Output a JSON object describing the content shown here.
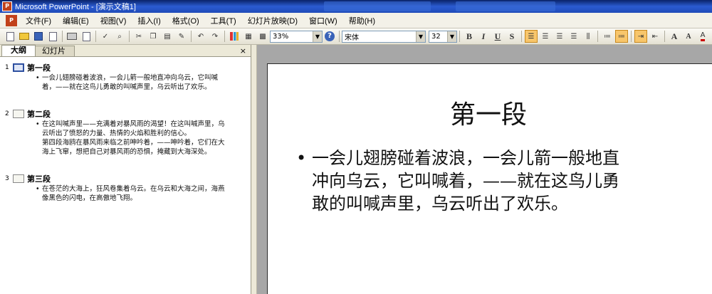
{
  "window": {
    "title": "Microsoft PowerPoint - [演示文稿1]"
  },
  "menu": [
    "文件(F)",
    "编辑(E)",
    "视图(V)",
    "插入(I)",
    "格式(O)",
    "工具(T)",
    "幻灯片放映(D)",
    "窗口(W)",
    "帮助(H)"
  ],
  "toolbar": {
    "zoom": "33%",
    "font_name": "宋体",
    "font_size": "32",
    "bold": "B",
    "italic": "I",
    "underline": "U",
    "shadow": "S",
    "grow_font": "A",
    "shrink_font": "A"
  },
  "pane": {
    "tab_outline": "大纲",
    "tab_slides": "幻灯片",
    "close": "×"
  },
  "outline": [
    {
      "num": "1",
      "title": "第一段",
      "lines": [
        "一会儿翅膀碰着波浪，一会儿箭一般地直冲向乌云，它叫喊",
        "着，——就在这鸟儿勇敢的叫喊声里，乌云听出了欢乐。"
      ]
    },
    {
      "num": "2",
      "title": "第二段",
      "lines": [
        "在这叫喊声里——充满着对暴风雨的渴望！在这叫喊声里，乌",
        "云听出了愤怒的力量、热情的火焰和胜利的信心。",
        "第四段海鸥在暴风雨来临之前呻吟着，——呻吟着，它们在大",
        "海上飞窜，想把自己对暴风雨的恐惧，掩藏到大海深处。"
      ]
    },
    {
      "num": "3",
      "title": "第三段",
      "lines": [
        "在苍茫的大海上，狂风卷集着乌云。在乌云和大海之间，海燕",
        "像黑色的闪电，在高傲地飞翔。"
      ]
    }
  ],
  "slide": {
    "title": "第一段",
    "body_lines": [
      "一会儿翅膀碰着波浪，一会儿箭一般地直",
      "冲向乌云，它叫喊着，——就在这鸟儿勇",
      "敢的叫喊声里，乌云听出了欢乐。"
    ]
  }
}
